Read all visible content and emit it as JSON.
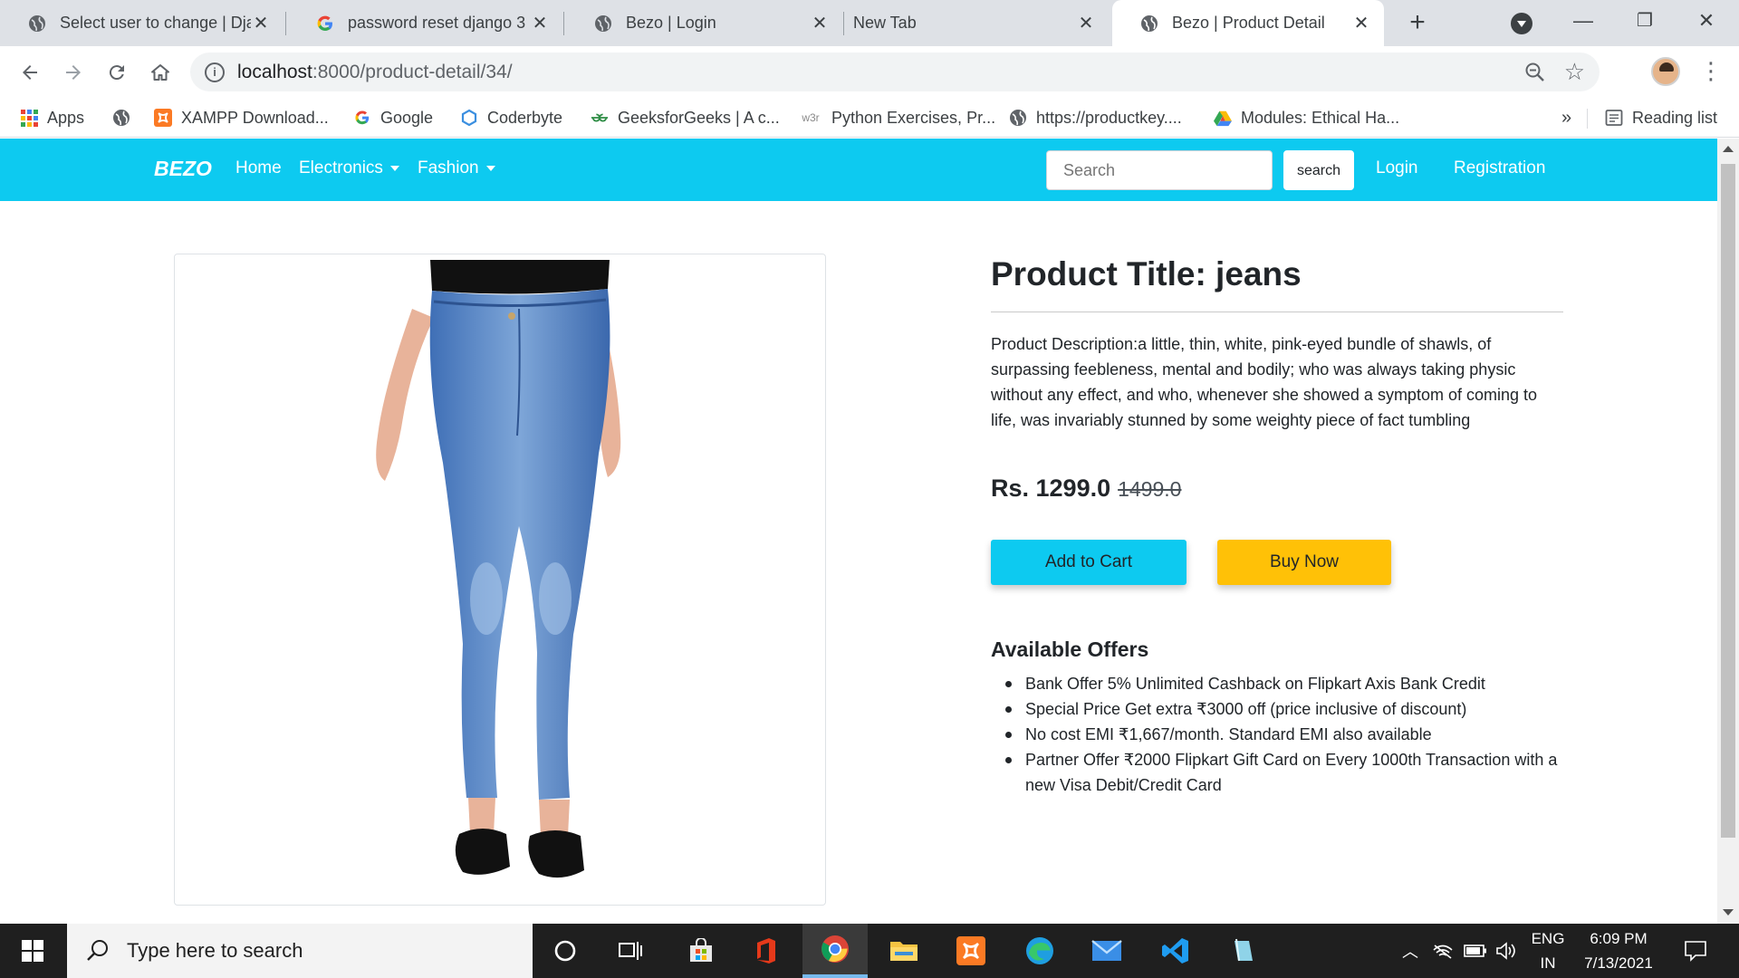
{
  "browser": {
    "tabs": [
      {
        "title": "Select user to change | Dja",
        "favicon": "globe-icon"
      },
      {
        "title": "password reset django 3 -",
        "favicon": "google-icon"
      },
      {
        "title": "Bezo | Login",
        "favicon": "globe-icon"
      },
      {
        "title": "New Tab",
        "favicon": ""
      },
      {
        "title": "Bezo | Product Detail",
        "favicon": "globe-icon"
      }
    ],
    "new_tab": "+",
    "url_host": "localhost",
    "url_path": ":8000/product-detail/34/",
    "bookmarks": [
      {
        "label": "Apps",
        "icon": "apps-grid-icon"
      },
      {
        "label": "",
        "icon": "globe-icon"
      },
      {
        "label": "XAMPP Download...",
        "icon": "xampp-icon"
      },
      {
        "label": "Google",
        "icon": "google-icon"
      },
      {
        "label": "Coderbyte",
        "icon": "coderbyte-icon"
      },
      {
        "label": "GeeksforGeeks | A c...",
        "icon": "gfg-icon"
      },
      {
        "label": "Python Exercises, Pr...",
        "icon": "w3r-icon"
      },
      {
        "label": "https://productkey....",
        "icon": "globe-icon"
      },
      {
        "label": "Modules: Ethical Ha...",
        "icon": "drive-icon"
      }
    ],
    "bookmarks_more": "»",
    "reading_list": "Reading list"
  },
  "site": {
    "brand": "BEZO",
    "nav": {
      "home": "Home",
      "electronics": "Electronics",
      "fashion": "Fashion",
      "login": "Login",
      "registration": "Registration"
    },
    "search_placeholder": "Search",
    "search_button": "search",
    "accent": "#0dcaf0",
    "buy_color": "#ffc107"
  },
  "product": {
    "title": "Product Title: jeans",
    "description": "Product Description:a little, thin, white, pink-eyed bundle of shawls, of surpassing feebleness, mental and bodily; who was always taking physic without any effect, and who, whenever she showed a symptom of coming to life, was invariably stunned by some weighty piece of fact tumbling",
    "price": "Rs. 1299.0",
    "old_price": "1499.0",
    "add_to_cart": "Add to Cart",
    "buy_now": "Buy Now",
    "offers_title": "Available Offers",
    "offers": [
      "Bank Offer 5% Unlimited Cashback on Flipkart Axis Bank Credit",
      "Special Price Get extra ₹3000 off (price inclusive of discount)",
      "No cost EMI ₹1,667/month. Standard EMI also available",
      "Partner Offer ₹2000 Flipkart Gift Card on Every 1000th Transaction with a new Visa Debit/Credit Card"
    ]
  },
  "taskbar": {
    "search_placeholder": "Type here to search",
    "lang_top": "ENG",
    "lang_bottom": "IN",
    "time": "6:09 PM",
    "date": "7/13/2021"
  }
}
